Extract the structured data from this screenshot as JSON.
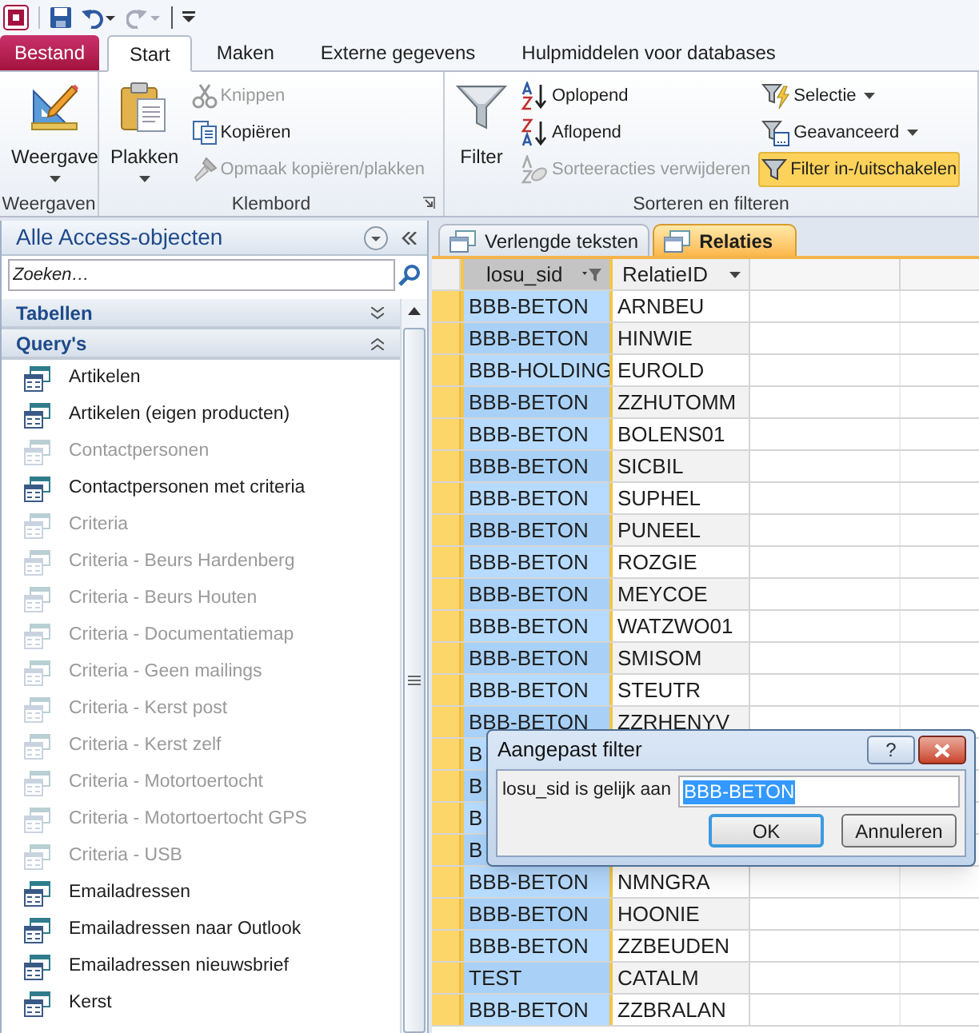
{
  "ribbon_tabs": [
    {
      "label": "Bestand",
      "kind": "file",
      "selected": false
    },
    {
      "label": "Start",
      "kind": "tab",
      "selected": true
    },
    {
      "label": "Maken",
      "kind": "tab",
      "selected": false
    },
    {
      "label": "Externe gegevens",
      "kind": "tab",
      "selected": false
    },
    {
      "label": "Hulpmiddelen voor databases",
      "kind": "tab",
      "selected": false
    }
  ],
  "ribbon_groups": [
    {
      "label": "Weergaven",
      "launcher": false,
      "commands": [
        {
          "label": "Weergave",
          "kind": "large",
          "dropdown": true,
          "disabled": false,
          "active": false
        }
      ]
    },
    {
      "label": "Klembord",
      "launcher": true,
      "commands": [
        {
          "label": "Plakken",
          "kind": "large",
          "dropdown": true,
          "disabled": false,
          "active": false
        },
        {
          "label": "Knippen",
          "kind": "small",
          "dropdown": false,
          "disabled": true,
          "active": false
        },
        {
          "label": "Kopiëren",
          "kind": "small",
          "dropdown": false,
          "disabled": false,
          "active": false
        },
        {
          "label": "Opmaak kopiëren/plakken",
          "kind": "small",
          "dropdown": false,
          "disabled": true,
          "active": false
        }
      ]
    },
    {
      "label": "Sorteren en filteren",
      "launcher": false,
      "commands": [
        {
          "label": "Filter",
          "kind": "large",
          "dropdown": false,
          "disabled": false,
          "active": false
        },
        {
          "label": "Oplopend",
          "kind": "small",
          "dropdown": false,
          "disabled": false,
          "active": false
        },
        {
          "label": "Aflopend",
          "kind": "small",
          "dropdown": false,
          "disabled": false,
          "active": false
        },
        {
          "label": "Sorteeracties verwijderen",
          "kind": "small",
          "dropdown": false,
          "disabled": true,
          "active": false
        },
        {
          "label": "Selectie",
          "kind": "small",
          "dropdown": true,
          "disabled": false,
          "active": false
        },
        {
          "label": "Geavanceerd",
          "kind": "small",
          "dropdown": true,
          "disabled": false,
          "active": false
        },
        {
          "label": "Filter in-/uitschakelen",
          "kind": "small",
          "dropdown": false,
          "disabled": false,
          "active": true
        }
      ]
    }
  ],
  "navigation_pane": {
    "title": "Alle Access-objecten",
    "search_placeholder": "Zoeken…",
    "groups": [
      {
        "label": "Tabellen",
        "expanded": false
      },
      {
        "label": "Query's",
        "expanded": true,
        "items": [
          {
            "label": "Artikelen",
            "disabled": false
          },
          {
            "label": "Artikelen (eigen producten)",
            "disabled": false
          },
          {
            "label": "Contactpersonen",
            "disabled": true
          },
          {
            "label": "Contactpersonen met criteria",
            "disabled": false
          },
          {
            "label": "Criteria",
            "disabled": true
          },
          {
            "label": "Criteria - Beurs Hardenberg",
            "disabled": true
          },
          {
            "label": "Criteria - Beurs Houten",
            "disabled": true
          },
          {
            "label": "Criteria - Documentatiemap",
            "disabled": true
          },
          {
            "label": "Criteria - Geen mailings",
            "disabled": true
          },
          {
            "label": "Criteria - Kerst post",
            "disabled": true
          },
          {
            "label": "Criteria - Kerst zelf",
            "disabled": true
          },
          {
            "label": "Criteria - Motortoertocht",
            "disabled": true
          },
          {
            "label": "Criteria - Motortoertocht GPS",
            "disabled": true
          },
          {
            "label": "Criteria - USB",
            "disabled": true
          },
          {
            "label": "Emailadressen",
            "disabled": false
          },
          {
            "label": "Emailadressen naar Outlook",
            "disabled": false
          },
          {
            "label": "Emailadressen nieuwsbrief",
            "disabled": false
          },
          {
            "label": "Kerst",
            "disabled": false
          }
        ]
      }
    ]
  },
  "document_tabs": [
    {
      "label": "Verlengde teksten",
      "selected": false
    },
    {
      "label": "Relaties",
      "selected": true
    }
  ],
  "table": {
    "columns": [
      {
        "label": "losu_sid",
        "selected": true,
        "filtered": true
      },
      {
        "label": "RelatieID",
        "selected": false,
        "filtered": false
      }
    ],
    "rows": [
      {
        "cells": [
          "BBB-BETON",
          "ARNBEU"
        ]
      },
      {
        "cells": [
          "BBB-BETON",
          "HINWIE"
        ]
      },
      {
        "cells": [
          "BBB-HOLDING",
          "EUROLD"
        ]
      },
      {
        "cells": [
          "BBB-BETON",
          "ZZHUTOMM"
        ]
      },
      {
        "cells": [
          "BBB-BETON",
          "BOLENS01"
        ]
      },
      {
        "cells": [
          "BBB-BETON",
          "SICBIL"
        ]
      },
      {
        "cells": [
          "BBB-BETON",
          "SUPHEL"
        ]
      },
      {
        "cells": [
          "BBB-BETON",
          "PUNEEL"
        ]
      },
      {
        "cells": [
          "BBB-BETON",
          "ROZGIE"
        ]
      },
      {
        "cells": [
          "BBB-BETON",
          "MEYCOE"
        ]
      },
      {
        "cells": [
          "BBB-BETON",
          "WATZWO01"
        ]
      },
      {
        "cells": [
          "BBB-BETON",
          "SMISOM"
        ]
      },
      {
        "cells": [
          "BBB-BETON",
          "STEUTR"
        ]
      },
      {
        "cells": [
          "BBB-BETON",
          "ZZRHENYV"
        ]
      },
      {
        "cells": [
          "B"
        ]
      },
      {
        "cells": [
          "B"
        ]
      },
      {
        "cells": [
          "B"
        ]
      },
      {
        "cells": [
          "B"
        ]
      },
      {
        "cells": [
          "BBB-BETON",
          "NMNGRA"
        ]
      },
      {
        "cells": [
          "BBB-BETON",
          "HOONIE"
        ]
      },
      {
        "cells": [
          "BBB-BETON",
          "ZZBEUDEN"
        ]
      },
      {
        "cells": [
          "TEST",
          "CATALM"
        ]
      },
      {
        "cells": [
          "BBB-BETON",
          "ZZBRALAN"
        ]
      }
    ]
  },
  "dialog": {
    "title": "Aangepast filter",
    "help_button": "?",
    "label": "losu_sid is gelijk aan",
    "value": "BBB-BETON",
    "value_selected": true,
    "buttons": [
      {
        "label": "OK",
        "default": true
      },
      {
        "label": "Annuleren",
        "default": false
      }
    ]
  }
}
